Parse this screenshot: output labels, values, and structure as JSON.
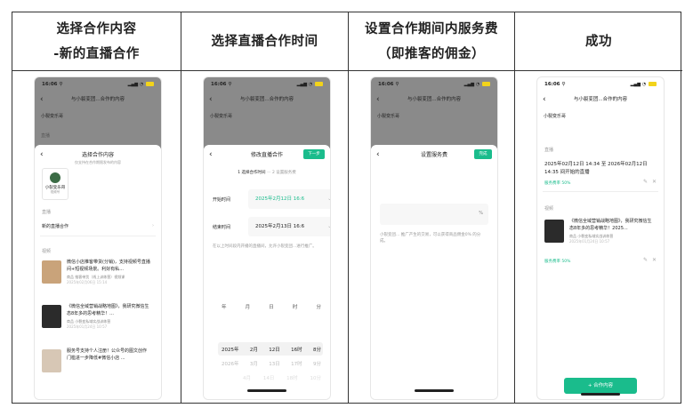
{
  "headers": [
    [
      "选择合作内容",
      "-新的直播合作"
    ],
    [
      "选择直播合作时间"
    ],
    [
      "设置合作期间内服务费",
      "（即推客的佣金）"
    ],
    [
      "成功"
    ]
  ],
  "status_time": "16:06",
  "page_title": "与小裂变团...合作的内容",
  "shop_name": "小裂变乐哥",
  "screen1": {
    "section_label": "直播",
    "sheet_title": "选择合作内容",
    "sheet_subtitle": "仅支持在合作期限发布的内容",
    "account_name": "小裂变乐哥",
    "account_tag": "视频号",
    "live_label": "直播",
    "new_live": "新的直播合作",
    "video_label": "视频",
    "videos": [
      {
        "title": "微信小店推客带货(分销)，支持视频号直播间+短视频场景。利好有私...",
        "meta": "商品  推客带货（线上训练营）视频课",
        "date": "2025年02月06日 15:14"
      },
      {
        "title": "《微信全域营销战略地图》，我研究微信生态8年多的思考精华！...",
        "meta": "商品  小裂变私域实战训练营",
        "date": "2025年01月24日 10:57"
      },
      {
        "title": "服务号支持个人注册！公众号的图文创作门槛进一步降低#微信小店 ...",
        "meta": "",
        "date": ""
      }
    ]
  },
  "screen2": {
    "sheet_title": "修改直播合作",
    "next": "下一步",
    "step1": "1 选择合作时间",
    "step2": "2 设置服务费",
    "start_label": "开始时间",
    "start_value": "2025年2月12日 16:6",
    "end_label": "结束时间",
    "end_value": "2025年2月13日 16:6",
    "hint": "在以上时间段内开播的直播间，允许小裂变团...进行推广。",
    "picker_heads": [
      "年",
      "月",
      "日",
      "时",
      "分"
    ],
    "picker_rows": [
      [
        "2025年",
        "2月",
        "12日",
        "16时",
        "8分"
      ],
      [
        "2026年",
        "3月",
        "13日",
        "17时",
        "9分"
      ],
      [
        "",
        "4月",
        "14日",
        "18时",
        "10分"
      ]
    ]
  },
  "screen3": {
    "sheet_title": "设置服务费",
    "done": "完成",
    "percent": "%",
    "hint": "小裂变团... 推广产生的交易，可以获得商品佣金0% 的分成。"
  },
  "screen4": {
    "live_label": "直播",
    "live_desc": "2025年02月12日 14:34 至 2026年02月12日 14:35 间开始的直播",
    "live_fee": "服务费率 50%",
    "video_label": "视频",
    "video_title": "《微信全域营销战略地图》，我研究微信生态8年多的思考精华！2025...",
    "video_meta": "商品  小裂变私域实战训练营",
    "video_date": "2025年01月24日 10:57",
    "video_fee": "服务费率 50%",
    "add_button": "+ 合作内容"
  }
}
